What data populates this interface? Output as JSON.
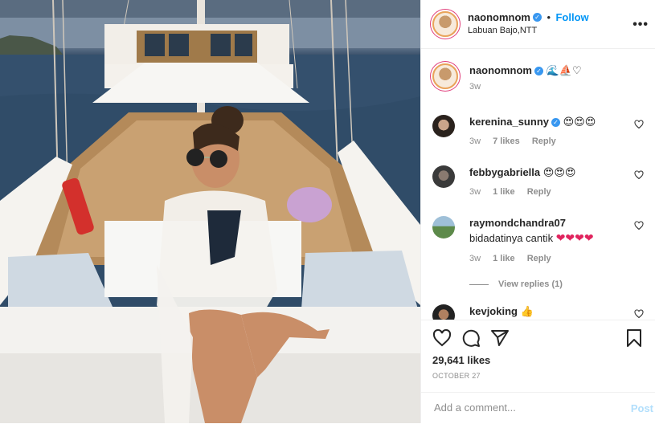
{
  "header": {
    "username": "naonomnom",
    "follow_label": "Follow",
    "dot": "•",
    "location": "Labuan Bajo,NTT",
    "more": "•••"
  },
  "caption": {
    "username": "naonomnom",
    "emoji_text": "🌊⛵♡",
    "time": "3w"
  },
  "comments": [
    {
      "username": "kerenina_sunny",
      "verified": true,
      "emoji": "😍😍😍",
      "time": "3w",
      "likes": "7 likes",
      "reply": "Reply"
    },
    {
      "username": "febbygabriella",
      "verified": false,
      "emoji": "😍😍😍",
      "time": "3w",
      "likes": "1 like",
      "reply": "Reply"
    },
    {
      "username": "raymondchandra07",
      "verified": false,
      "text": "bidadatinya cantik",
      "emoji": "❤❤❤❤",
      "time": "3w",
      "likes": "1 like",
      "reply": "Reply"
    },
    {
      "username": "kevjoking",
      "verified": false,
      "emoji": "👍"
    }
  ],
  "view_replies": "View replies (1)",
  "stats": {
    "likes": "29,641 likes",
    "date": "OCTOBER 27"
  },
  "add_comment": {
    "placeholder": "Add a comment...",
    "post_label": "Post"
  },
  "colors": {
    "link_blue": "#0095f6",
    "secondary_gray": "#8e8e8e",
    "border": "#efefef"
  },
  "icons": [
    "heart-icon",
    "comment-icon",
    "share-icon",
    "bookmark-icon",
    "verified-icon",
    "more-icon"
  ]
}
